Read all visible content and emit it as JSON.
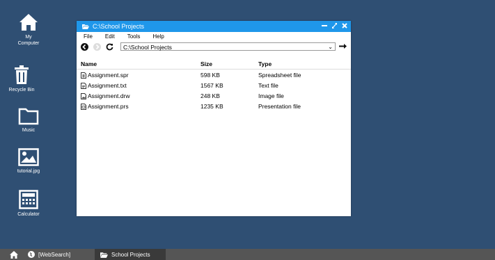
{
  "desktop": {
    "icons": [
      {
        "label": "My\nComputer",
        "icon": "home-icon"
      },
      {
        "label": "Recycle Bin",
        "icon": "trash-icon"
      },
      {
        "label": "Music",
        "icon": "folder-icon"
      },
      {
        "label": "tutorial.jpg",
        "icon": "image-icon"
      },
      {
        "label": "Calculator",
        "icon": "calculator-icon"
      }
    ],
    "icon_my_computer_line1": "My",
    "icon_my_computer_line2": "Computer"
  },
  "window": {
    "title": "C:\\School Projects",
    "menu": [
      "File",
      "Edit",
      "Tools",
      "Help"
    ],
    "address": "C:\\School Projects",
    "columns": [
      "Name",
      "Size",
      "Type"
    ],
    "files": [
      {
        "name": "Assignment.spr",
        "size": "598 KB",
        "type": "Spreadsheet file"
      },
      {
        "name": "Assignment.txt",
        "size": "1567 KB",
        "type": "Text file"
      },
      {
        "name": "Assignment.drw",
        "size": "248 KB",
        "type": "Image file"
      },
      {
        "name": "Assignment.prs",
        "size": "1235 KB",
        "type": "Presentation file"
      }
    ]
  },
  "taskbar": {
    "items": [
      {
        "label": "[WebSearch]"
      },
      {
        "label": "School Projects"
      }
    ]
  },
  "colors": {
    "desktop": "#2f4f73",
    "titlebar": "#1f97ea",
    "taskbar": "#555555"
  }
}
